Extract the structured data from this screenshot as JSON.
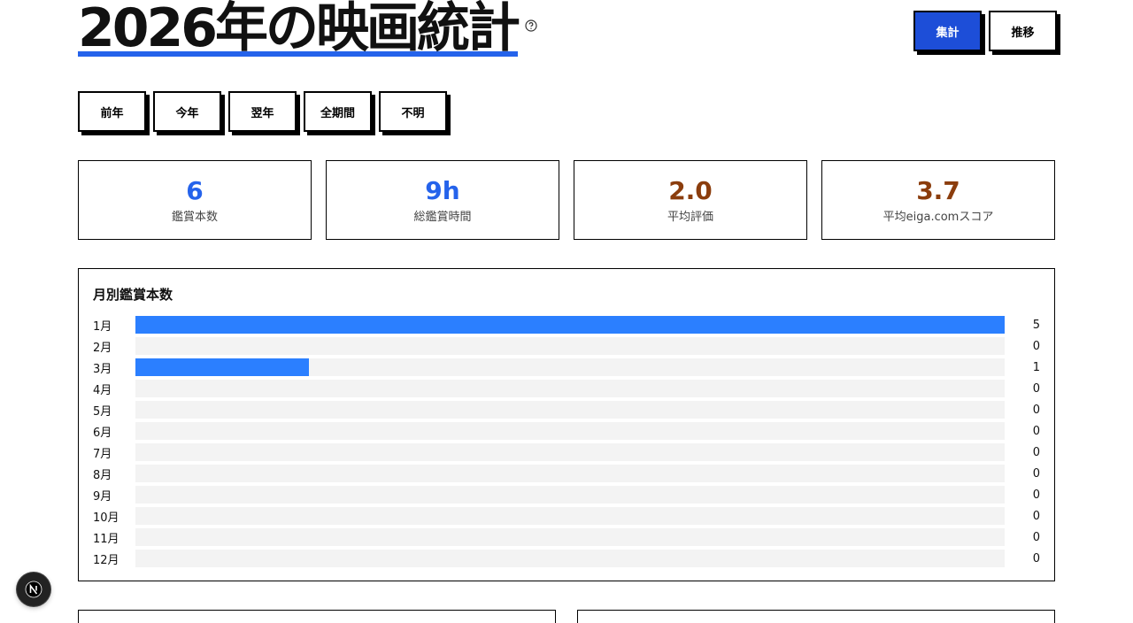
{
  "header": {
    "title": "2026年の映画統計",
    "help_icon": "question-circle-icon"
  },
  "view_toggle": {
    "aggregate_label": "集計",
    "trend_label": "推移",
    "active": "aggregate"
  },
  "period_tabs": [
    {
      "label": "前年"
    },
    {
      "label": "今年"
    },
    {
      "label": "翌年"
    },
    {
      "label": "全期間"
    },
    {
      "label": "不明"
    }
  ],
  "stats": [
    {
      "value": "6",
      "label": "鑑賞本数",
      "color": "#2563eb"
    },
    {
      "value": "9h",
      "label": "総鑑賞時間",
      "color": "#2563eb"
    },
    {
      "value": "2.0",
      "label": "平均評価",
      "color": "#8b3d0d"
    },
    {
      "value": "3.7",
      "label": "平均eiga.comスコア",
      "color": "#8b3d0d"
    }
  ],
  "monthly": {
    "title": "月別鑑賞本数"
  },
  "chart_data": {
    "type": "bar",
    "orientation": "horizontal",
    "categories": [
      "1月",
      "2月",
      "3月",
      "4月",
      "5月",
      "6月",
      "7月",
      "8月",
      "9月",
      "10月",
      "11月",
      "12月"
    ],
    "values": [
      5,
      0,
      1,
      0,
      0,
      0,
      0,
      0,
      0,
      0,
      0,
      0
    ],
    "xlim": [
      0,
      5
    ],
    "bar_color": "#2b7fff"
  },
  "dev_badge": {
    "icon": "nextjs-logo-icon",
    "letter": "N"
  }
}
